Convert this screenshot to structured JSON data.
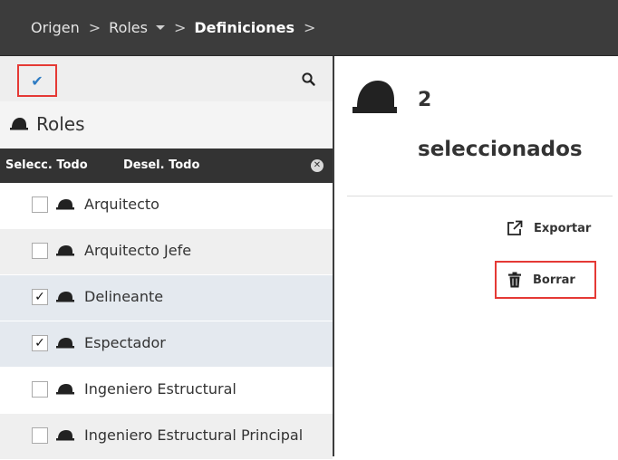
{
  "breadcrumb": {
    "items": [
      {
        "label": "Origen"
      },
      {
        "label": "Roles",
        "has_dropdown": true
      },
      {
        "label": "Definiciones",
        "current": true
      }
    ]
  },
  "toolbar": {
    "select_toggle_icon": "checkmark-icon",
    "search_icon": "search-icon"
  },
  "left_panel": {
    "title": "Roles",
    "title_icon": "hard-hat-icon",
    "select_all_label": "Selecc. Todo",
    "deselect_all_label": "Desel. Todo",
    "clear_icon": "clear-circle-x-icon",
    "roles": [
      {
        "label": "Arquitecto",
        "checked": false
      },
      {
        "label": "Arquitecto Jefe",
        "checked": false
      },
      {
        "label": "Delineante",
        "checked": true
      },
      {
        "label": "Espectador",
        "checked": true
      },
      {
        "label": "Ingeniero Estructural",
        "checked": false
      },
      {
        "label": "Ingeniero Estructural Principal",
        "checked": false
      }
    ]
  },
  "right_panel": {
    "count": "2",
    "count_label": "seleccionados",
    "actions": {
      "export_label": "Exportar",
      "export_icon": "external-link-icon",
      "delete_label": "Borrar",
      "delete_icon": "trash-icon"
    }
  },
  "colors": {
    "topbar_bg": "#3c3c3c",
    "highlight_border": "#e53935",
    "check_accent": "#2e7cc3",
    "selected_row_bg": "#e4e9ef"
  }
}
